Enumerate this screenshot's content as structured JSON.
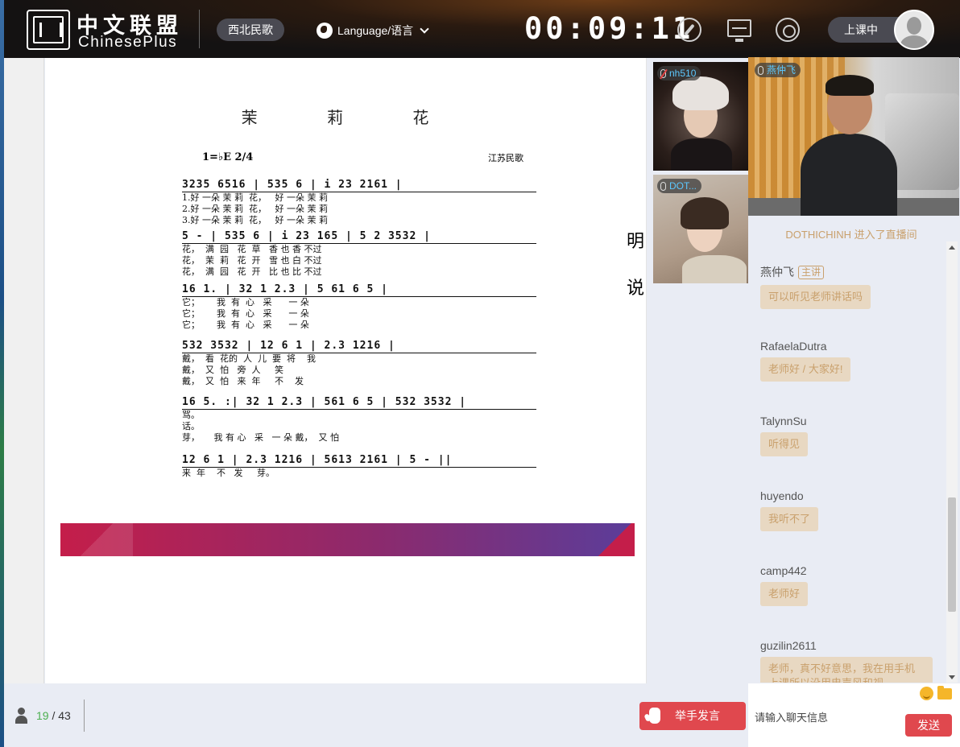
{
  "header": {
    "logo_cn": "中文联盟",
    "logo_en": "ChinesePlus",
    "course_name": "西北民歌",
    "language_label": "Language/语言",
    "timer": "00:09:11",
    "status_label": "上课中",
    "icons": [
      "compass-icon",
      "monitor-icon",
      "signal-icon",
      "globe-icon",
      "avatar"
    ]
  },
  "courseware": {
    "song_title": "茉 莉 花",
    "key": "1=♭E 2/4",
    "origin": "江苏民歌",
    "lines": [
      {
        "notes": "3235 6516 | 535 6 | i 23 2161 |",
        "lyrics": [
          "1.好 一朵 茉 莉  花，   好 一朵 茉 莉",
          "2.好 一朵 茉 莉  花，   好 一朵 茉 莉",
          "3.好 一朵 茉 莉  花，   好 一朵 茉 莉"
        ]
      },
      {
        "notes": "5 - | 535 6 | i 23 165 | 5 2 3532 |",
        "lyrics": [
          "花，  满  园   花  草   香 也 香 不过",
          "花，  茉  莉   花  开   雪 也 白 不过",
          "花，  满  园   花  开   比 也 比 不过"
        ]
      },
      {
        "notes": "16 1. | 32 1 2.3 | 5 61 6 5 |",
        "lyrics": [
          "它；      我  有  心   采      一 朵",
          "它；      我  有  心   采      一 朵",
          "它；      我  有  心   采      一 朵"
        ]
      },
      {
        "notes": "532 3532 | 12 6 1 | 2.3 1216 |",
        "lyrics": [
          "戴，  看  花的  人  儿  要  将    我",
          "戴，  又  怕   旁  人     笑",
          "戴，  又  怕   来  年     不    发"
        ]
      },
      {
        "notes": "16 5. :| 32 1 2.3 | 561 6 5 | 532 3532 |",
        "lyrics": [
          "骂。",
          "话。",
          "芽，     我 有 心   采   一 朵 戴，  又 怕"
        ]
      },
      {
        "notes": "12 6 1 | 2.3 1216 | 5613 2161 | 5 - ||",
        "lyrics": [
          "来  年    不   发     芽。"
        ]
      }
    ],
    "side_chars": [
      "明",
      "说"
    ]
  },
  "videos": {
    "student1": {
      "name": "nh510",
      "muted": true
    },
    "student2": {
      "name": "DOT..."
    },
    "teacher": {
      "name": "燕仲飞"
    }
  },
  "chat": {
    "join_notice": "DOTHICHINH 进入了直播间",
    "messages": [
      {
        "name": "燕仲飞",
        "role": "主讲",
        "text": "可以听见老师讲话吗"
      },
      {
        "name": "RafaelaDutra",
        "text": "老师好 / 大家好!"
      },
      {
        "name": "TalynnSu",
        "text": "听得见"
      },
      {
        "name": "huyendo",
        "text": "我听不了"
      },
      {
        "name": "camp442",
        "text": "老师好"
      },
      {
        "name": "guzilin2611",
        "text": "老师，真不好意思，我在用手机上课所以没用电声风和视"
      }
    ],
    "input_placeholder": "请输入聊天信息",
    "send_label": "发送"
  },
  "bottom": {
    "online_count": "19",
    "total_count": "/ 43",
    "raise_hand_label": "举手发言"
  },
  "colors": {
    "accent_red": "#e0484e",
    "chat_gold": "#c9a06c",
    "online_green": "#4caf50"
  }
}
